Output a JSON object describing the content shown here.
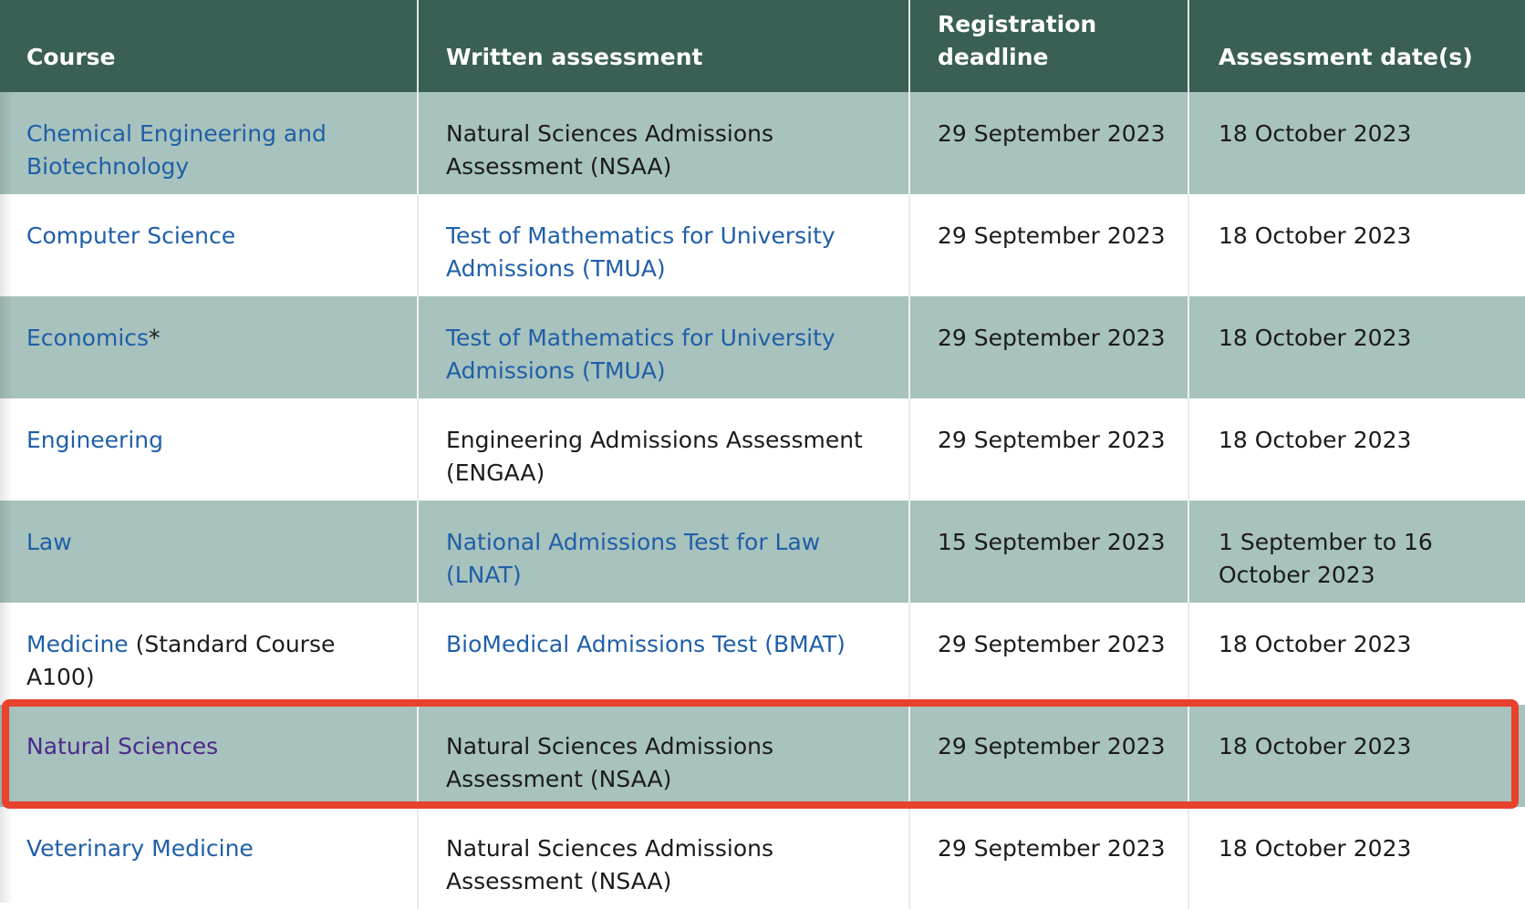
{
  "headers": {
    "course": "Course",
    "assessment": "Written assessment",
    "deadline": "Registration deadline",
    "dates": "Assessment date(s)"
  },
  "rows": [
    {
      "course": "Chemical Engineering and Biotechnology",
      "course_note": "",
      "assessment": "Natural Sciences Admissions Assessment (NSAA)",
      "deadline": "29 September 2023",
      "dates": "18 October 2023"
    },
    {
      "course": "Computer Science",
      "course_note": "",
      "assessment": "Test of Mathematics for University Admissions (TMUA)",
      "deadline": "29 September 2023",
      "dates": "18 October 2023"
    },
    {
      "course": "Economics",
      "course_note": "*",
      "assessment": "Test of Mathematics for University Admissions (TMUA)",
      "deadline": "29 September 2023",
      "dates": "18 October 2023"
    },
    {
      "course": "Engineering",
      "course_note": "",
      "assessment": "Engineering Admissions Assessment (ENGAA)",
      "deadline": "29 September 2023",
      "dates": "18 October 2023"
    },
    {
      "course": "Law",
      "course_note": "",
      "assessment": "National Admissions Test for Law (LNAT)",
      "deadline": "15 September 2023",
      "dates": "1 September to 16 October 2023"
    },
    {
      "course": "Medicine",
      "course_note": " (Standard Course A100)",
      "assessment": "BioMedical Admissions Test (BMAT)",
      "deadline": "29 September 2023",
      "dates": "18 October 2023"
    },
    {
      "course": "Natural Sciences",
      "course_note": "",
      "assessment": "Natural Sciences Admissions Assessment (NSAA)",
      "deadline": "29 September 2023",
      "dates": "18 October 2023"
    },
    {
      "course": "Veterinary Medicine",
      "course_note": "",
      "assessment": "Natural Sciences Admissions Assessment (NSAA)",
      "deadline": "29 September 2023",
      "dates": "18 October 2023"
    }
  ],
  "colors": {
    "header_bg": "#3a5f55",
    "row_shade": "#a8c2bd",
    "link": "#1f5fa8",
    "visited_link": "#4b2a8c",
    "highlight_border": "#e8412c"
  }
}
